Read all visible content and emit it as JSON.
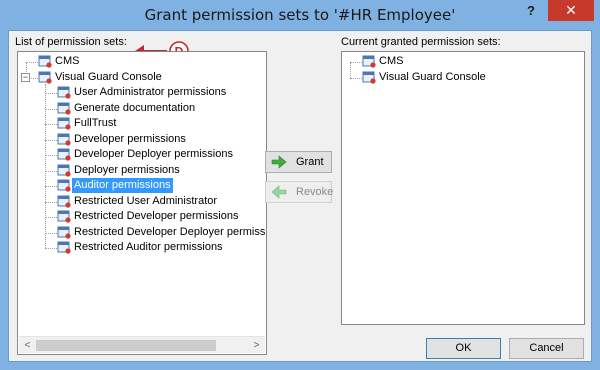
{
  "window": {
    "title": "Grant permission sets to '#HR Employee'",
    "help_label": "?",
    "close_label": "✕"
  },
  "left_panel": {
    "label": "List of permission sets:",
    "annotation_letter": "D",
    "tree": [
      {
        "label": "CMS",
        "level": 0,
        "icon": "permission-set-icon"
      },
      {
        "label": "Visual Guard Console",
        "level": 0,
        "icon": "permission-set-icon",
        "expander": "−"
      },
      {
        "label": "User Administrator permissions",
        "level": 1,
        "icon": "permission-set-icon"
      },
      {
        "label": "Generate documentation",
        "level": 1,
        "icon": "permission-set-icon"
      },
      {
        "label": "FullTrust",
        "level": 1,
        "icon": "permission-set-icon"
      },
      {
        "label": "Developer permissions",
        "level": 1,
        "icon": "permission-set-icon"
      },
      {
        "label": "Developer Deployer permissions",
        "level": 1,
        "icon": "permission-set-icon"
      },
      {
        "label": "Deployer permissions",
        "level": 1,
        "icon": "permission-set-icon"
      },
      {
        "label": "Auditor permissions",
        "level": 1,
        "icon": "permission-set-icon",
        "selected": true
      },
      {
        "label": "Restricted User Administrator",
        "level": 1,
        "icon": "permission-set-icon"
      },
      {
        "label": "Restricted Developer permissions",
        "level": 1,
        "icon": "permission-set-icon"
      },
      {
        "label": "Restricted Developer Deployer permiss",
        "level": 1,
        "icon": "permission-set-icon"
      },
      {
        "label": "Restricted Auditor permissions",
        "level": 1,
        "icon": "permission-set-icon"
      }
    ],
    "scroll_left": "<",
    "scroll_right": ">"
  },
  "right_panel": {
    "label": "Current granted permission sets:",
    "tree": [
      {
        "label": "CMS",
        "level": 0,
        "icon": "permission-set-icon"
      },
      {
        "label": "Visual Guard Console",
        "level": 0,
        "icon": "permission-set-icon"
      }
    ]
  },
  "buttons": {
    "grant": "Grant",
    "revoke": "Revoke",
    "ok": "OK",
    "cancel": "Cancel"
  },
  "colors": {
    "titlebar": "#7fb1e3",
    "close": "#c7392b",
    "selection": "#3399ff",
    "annotation": "#c0282d",
    "grant_arrow": "#3fae3f",
    "revoke_arrow": "#9ad39a"
  }
}
